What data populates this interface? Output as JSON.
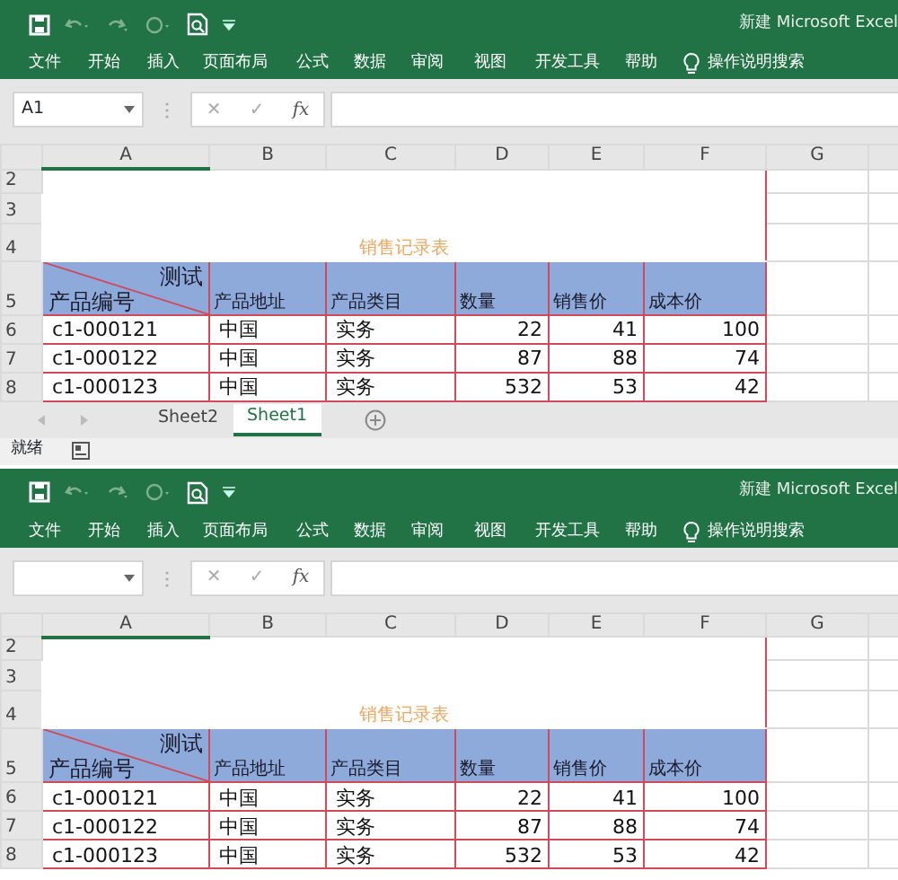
{
  "windows": [
    {
      "title": "新建 Microsoft Excel",
      "ribbon_tabs": [
        "文件",
        "开始",
        "插入",
        "页面布局",
        "公式",
        "数据",
        "审阅",
        "视图",
        "开发工具",
        "帮助"
      ],
      "tell_me": "操作说明搜索",
      "name_box": "A1",
      "formula_buttons": {
        "cancel": "✕",
        "enter": "✓",
        "function": "fx"
      },
      "columns": [
        {
          "label": "A",
          "selected": true,
          "numeric": false
        },
        {
          "label": "B",
          "selected": false,
          "numeric": false
        },
        {
          "label": "C",
          "selected": false,
          "numeric": false
        },
        {
          "label": "D",
          "selected": false,
          "numeric": true
        },
        {
          "label": "E",
          "selected": false,
          "numeric": true
        },
        {
          "label": "F",
          "selected": false,
          "numeric": true
        },
        {
          "label": "G",
          "selected": false
        }
      ],
      "sheet": {
        "row_numbers": [
          "2",
          "3",
          "4",
          "5",
          "6",
          "7",
          "8"
        ],
        "title": "销售记录表",
        "diagonal": {
          "top": "测试",
          "bottom": "产品编号"
        },
        "headers": [
          "产品地址",
          "产品类目",
          "数量",
          "销售价",
          "成本价"
        ],
        "rows": [
          [
            "c1-000121",
            "中国",
            "实务",
            "22",
            "41",
            "100"
          ],
          [
            "c1-000122",
            "中国",
            "实务",
            "87",
            "88",
            "74"
          ],
          [
            "c1-000123",
            "中国",
            "实务",
            "532",
            "53",
            "42"
          ]
        ]
      },
      "sheet_tabs": [
        {
          "label": "Sheet2",
          "selected": false
        },
        {
          "label": "Sheet1",
          "selected": true
        }
      ],
      "status_bar": {
        "text": "就绪"
      }
    },
    {
      "title": "新建 Microsoft Excel",
      "ribbon_tabs": [
        "文件",
        "开始",
        "插入",
        "页面布局",
        "公式",
        "数据",
        "审阅",
        "视图",
        "开发工具",
        "帮助"
      ],
      "tell_me": "操作说明搜索",
      "formula_buttons": {
        "cancel": "✕",
        "enter": "✓",
        "function": "fx"
      },
      "columns": [
        {
          "label": "A",
          "selected": true,
          "numeric": false
        },
        {
          "label": "B",
          "selected": false,
          "numeric": false
        },
        {
          "label": "C",
          "selected": false,
          "numeric": false
        },
        {
          "label": "D",
          "selected": false,
          "numeric": true
        },
        {
          "label": "E",
          "selected": false,
          "numeric": true
        },
        {
          "label": "F",
          "selected": false,
          "numeric": true
        },
        {
          "label": "G",
          "selected": false
        }
      ],
      "sheet": {
        "row_numbers": [
          "2",
          "3",
          "4",
          "5",
          "6",
          "7",
          "8"
        ],
        "title": "销售记录表",
        "diagonal": {
          "top": "测试",
          "bottom": "产品编号"
        },
        "headers": [
          "产品地址",
          "产品类目",
          "数量",
          "销售价",
          "成本价"
        ],
        "rows": [
          [
            "c1-000121",
            "中国",
            "实务",
            "22",
            "41",
            "100"
          ],
          [
            "c1-000122",
            "中国",
            "实务",
            "87",
            "88",
            "74"
          ],
          [
            "c1-000123",
            "中国",
            "实务",
            "532",
            "53",
            "42"
          ]
        ]
      }
    }
  ]
}
